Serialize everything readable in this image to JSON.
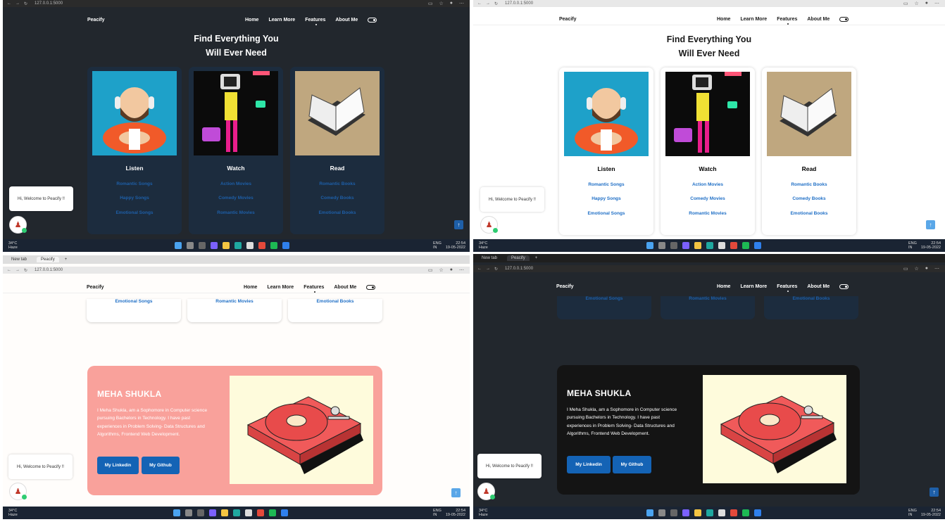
{
  "browser": {
    "address": "127.0.0.1:5000",
    "tab_new": "New tab",
    "tab_site": "Peacify"
  },
  "nav": {
    "brand": "Peacify",
    "links": [
      "Home",
      "Learn More",
      "Features",
      "About Me"
    ],
    "active": "Features"
  },
  "heading": {
    "line1": "Find Everything You",
    "line2": "Will Ever Need"
  },
  "cards": [
    {
      "title": "Listen",
      "links": [
        "Romantic Songs",
        "Happy Songs",
        "Emotional Songs"
      ]
    },
    {
      "title": "Watch",
      "links": [
        "Action Movies",
        "Comedy Movies",
        "Romantic Movies"
      ]
    },
    {
      "title": "Read",
      "links": [
        "Romantic Books",
        "Comedy Books",
        "Emotional Books"
      ]
    }
  ],
  "chat": {
    "message": "Hi, Welcome to Peacify !!"
  },
  "profile": {
    "name": "MEHA SHUKLA",
    "desc": "I Meha Shukla, am a Sophomore in Computer science pursuing Bachelors in Technology. I have past experiences in Problem Solving- Data Structures and Algorithms, Frontend Web Development.",
    "btn_linkedin": "My Linkedin",
    "btn_github": "My Github"
  },
  "taskbar": {
    "temp": "34°C",
    "condition": "Haze",
    "lang1": "ENG",
    "lang2": "IN",
    "time": "22:54",
    "date": "19-05-2022"
  },
  "colors": {
    "dark_bg": "#22272d",
    "card_dark": "#1c2c3e",
    "link_blue": "#1f6fc6",
    "profile_light": "#f9a19b",
    "profile_dark": "#141414",
    "button_blue": "#1463b5"
  },
  "icons": {
    "dark_mode_toggle": "toggle-icon",
    "scroll_top": "arrow-up-icon",
    "avatar": "dancer-avatar-icon"
  }
}
